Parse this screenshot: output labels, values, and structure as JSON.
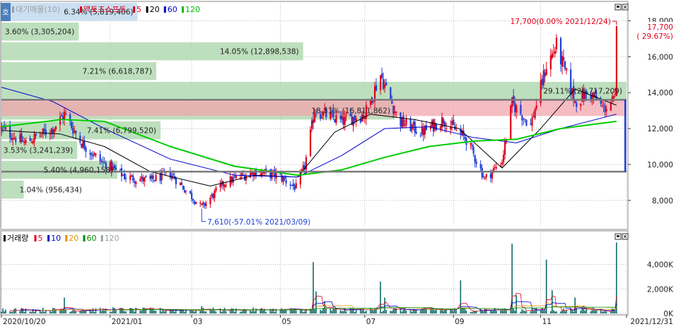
{
  "header": {
    "main_legend": [
      {
        "text": "대기매물(10)",
        "color": "#9aa0a6"
      },
      {
        "text": "액토즈소프트",
        "color": "#e0001a"
      },
      {
        "text": "5",
        "color": "#e0001a"
      },
      {
        "text": "20",
        "color": "#000000"
      },
      {
        "text": "60",
        "color": "#0000cc"
      },
      {
        "text": "120",
        "color": "#00bb00"
      }
    ],
    "volume_legend": [
      {
        "text": "거래량",
        "color": "#000000"
      },
      {
        "text": "5",
        "color": "#e0001a"
      },
      {
        "text": "10",
        "color": "#0000cc"
      },
      {
        "text": "20",
        "color": "#e09000"
      },
      {
        "text": "60",
        "color": "#008800"
      },
      {
        "text": "120",
        "color": "#9aa0a6"
      }
    ],
    "tab_label": "호"
  },
  "colors": {
    "up": "#e0001a",
    "down": "#1f3fd6",
    "ma5": "#e0001a",
    "ma20": "#000000",
    "ma60": "#0000cc",
    "ma120": "#00cc00",
    "supply_bar": "#b6dcb6",
    "supply_bar_top": "#c5dcee",
    "resistance_band": "#f2a6ad",
    "volume_bar": "#0f6b6b"
  },
  "chart_data": [
    {
      "type": "candlestick",
      "x_range": [
        "2020/10/20",
        "2021/12/31"
      ],
      "x_ticks": [
        {
          "date": "2020/10/20",
          "label": "2020/10/20"
        },
        {
          "date": "2021/01/04",
          "label": "2021/01"
        },
        {
          "date": "2021/03/02",
          "label": "03"
        },
        {
          "date": "2021/05/03",
          "label": "05"
        },
        {
          "date": "2021/07/01",
          "label": "07"
        },
        {
          "date": "2021/09/01",
          "label": "09"
        },
        {
          "date": "2021/11/01",
          "label": "11"
        },
        {
          "date": "2021/12/31",
          "label": "2021/12/31"
        }
      ],
      "ylim": [
        6500,
        19000
      ],
      "y_ticks": [
        8000,
        10000,
        12000,
        14000,
        16000,
        18000
      ],
      "y_tick_labels": [
        "8,000",
        "10,000",
        "12,000",
        "14,000",
        "16,000",
        "18,000"
      ],
      "grid": true,
      "last_price": {
        "value": 17700,
        "label_price": "17,700",
        "label_change": "( 29.67%)"
      },
      "supply_zones": [
        {
          "low": 18000,
          "high": 19000,
          "ratio": 0.0634,
          "label": "6.34% (5,819,406)"
        },
        {
          "low": 16900,
          "high": 17900,
          "ratio": 0.036,
          "label": "3.60% (3,305,204)"
        },
        {
          "low": 15800,
          "high": 16800,
          "ratio": 0.1405,
          "label": "14.05% (12,898,538)"
        },
        {
          "low": 14700,
          "high": 15700,
          "ratio": 0.0721,
          "label": "7.21% (6,618,787)"
        },
        {
          "low": 13600,
          "high": 14600,
          "ratio": 0.2911,
          "label": "29.11% (26,717,209)"
        },
        {
          "low": 12500,
          "high": 13500,
          "ratio": 0.1831,
          "label": "18.31% (16,811,862)"
        },
        {
          "low": 11400,
          "high": 12400,
          "ratio": 0.0741,
          "label": "7.41% (6,799,520)"
        },
        {
          "low": 10300,
          "high": 11300,
          "ratio": 0.0353,
          "label": "3.53% (3,241,239)"
        },
        {
          "low": 9200,
          "high": 10200,
          "ratio": 0.054,
          "label": "5.40% (4,960,158)"
        },
        {
          "low": 8100,
          "high": 9100,
          "ratio": 0.0104,
          "label": "1.04% (956,434)"
        }
      ],
      "resistance_band": {
        "low": 12700,
        "high": 13600
      },
      "horizontal_lines": [
        13600,
        9600
      ],
      "annotations": [
        {
          "text": "17,700(0.00% 2021/12/24)",
          "date": "2021/12/24",
          "value": 17700,
          "kind": "high"
        },
        {
          "text": "7,610(-57.01% 2021/03/09)",
          "date": "2021/03/09",
          "value": 7610,
          "kind": "low"
        }
      ],
      "price_path": [
        {
          "date": "2020/10/20",
          "value": 12000
        },
        {
          "date": "2020/11/05",
          "value": 11200
        },
        {
          "date": "2020/11/25",
          "value": 12000
        },
        {
          "date": "2020/12/03",
          "value": 12800
        },
        {
          "date": "2020/12/15",
          "value": 11200
        },
        {
          "date": "2020/12/28",
          "value": 10200
        },
        {
          "date": "2021/01/15",
          "value": 9300
        },
        {
          "date": "2021/02/01",
          "value": 9100
        },
        {
          "date": "2021/02/15",
          "value": 9500
        },
        {
          "date": "2021/03/09",
          "value": 7610
        },
        {
          "date": "2021/03/25",
          "value": 9000
        },
        {
          "date": "2021/04/15",
          "value": 9600
        },
        {
          "date": "2021/05/01",
          "value": 9400
        },
        {
          "date": "2021/05/14",
          "value": 8700
        },
        {
          "date": "2021/05/20",
          "value": 9900
        },
        {
          "date": "2021/05/27",
          "value": 13000
        },
        {
          "date": "2021/06/15",
          "value": 12400
        },
        {
          "date": "2021/07/01",
          "value": 12800
        },
        {
          "date": "2021/07/12",
          "value": 15000
        },
        {
          "date": "2021/07/25",
          "value": 12400
        },
        {
          "date": "2021/08/10",
          "value": 11800
        },
        {
          "date": "2021/08/25",
          "value": 12500
        },
        {
          "date": "2021/09/10",
          "value": 11400
        },
        {
          "date": "2021/09/23",
          "value": 9200
        },
        {
          "date": "2021/10/05",
          "value": 10200
        },
        {
          "date": "2021/10/12",
          "value": 13400
        },
        {
          "date": "2021/10/25",
          "value": 12200
        },
        {
          "date": "2021/11/05",
          "value": 15500
        },
        {
          "date": "2021/11/12",
          "value": 16600
        },
        {
          "date": "2021/11/25",
          "value": 13500
        },
        {
          "date": "2021/12/05",
          "value": 14000
        },
        {
          "date": "2021/12/15",
          "value": 13100
        },
        {
          "date": "2021/12/23",
          "value": 13600
        },
        {
          "date": "2021/12/24",
          "value": 17700
        }
      ],
      "moving_averages": {
        "ma20": [
          {
            "date": "2020/10/20",
            "value": 11900
          },
          {
            "date": "2020/11/30",
            "value": 11700
          },
          {
            "date": "2020/12/31",
            "value": 11000
          },
          {
            "date": "2021/02/01",
            "value": 9600
          },
          {
            "date": "2021/03/15",
            "value": 8800
          },
          {
            "date": "2021/04/15",
            "value": 9400
          },
          {
            "date": "2021/05/15",
            "value": 9300
          },
          {
            "date": "2021/06/10",
            "value": 11800
          },
          {
            "date": "2021/07/05",
            "value": 12800
          },
          {
            "date": "2021/08/05",
            "value": 12500
          },
          {
            "date": "2021/09/05",
            "value": 12000
          },
          {
            "date": "2021/10/05",
            "value": 9800
          },
          {
            "date": "2021/11/01",
            "value": 12000
          },
          {
            "date": "2021/11/25",
            "value": 14200
          },
          {
            "date": "2021/12/24",
            "value": 13300
          }
        ],
        "ma60": [
          {
            "date": "2020/10/20",
            "value": 14300
          },
          {
            "date": "2020/11/25",
            "value": 13500
          },
          {
            "date": "2020/12/31",
            "value": 12000
          },
          {
            "date": "2021/02/15",
            "value": 10300
          },
          {
            "date": "2021/04/01",
            "value": 9400
          },
          {
            "date": "2021/05/15",
            "value": 9300
          },
          {
            "date": "2021/06/15",
            "value": 10500
          },
          {
            "date": "2021/07/15",
            "value": 12000
          },
          {
            "date": "2021/08/15",
            "value": 12100
          },
          {
            "date": "2021/09/15",
            "value": 11500
          },
          {
            "date": "2021/10/15",
            "value": 11200
          },
          {
            "date": "2021/11/15",
            "value": 12000
          },
          {
            "date": "2021/12/24",
            "value": 12800
          }
        ],
        "ma120": [
          {
            "date": "2020/10/20",
            "value": 12100
          },
          {
            "date": "2020/12/01",
            "value": 12500
          },
          {
            "date": "2020/12/31",
            "value": 12400
          },
          {
            "date": "2021/02/15",
            "value": 11000
          },
          {
            "date": "2021/04/01",
            "value": 9900
          },
          {
            "date": "2021/05/15",
            "value": 9400
          },
          {
            "date": "2021/06/15",
            "value": 9700
          },
          {
            "date": "2021/07/15",
            "value": 10400
          },
          {
            "date": "2021/08/15",
            "value": 11000
          },
          {
            "date": "2021/09/15",
            "value": 11300
          },
          {
            "date": "2021/10/15",
            "value": 11400
          },
          {
            "date": "2021/11/15",
            "value": 12000
          },
          {
            "date": "2021/12/24",
            "value": 12400
          }
        ]
      }
    },
    {
      "type": "bar",
      "title": "거래량",
      "ylim": [
        0,
        6000000
      ],
      "y_ticks": [
        0,
        2000000,
        4000000
      ],
      "y_tick_labels": [
        "0K",
        "2,000K",
        "4,000K"
      ],
      "baseline": 300000,
      "spikes": [
        {
          "date": "2020/12/03",
          "value": 1300000
        },
        {
          "date": "2021/01/06",
          "value": 500000
        },
        {
          "date": "2021/03/09",
          "value": 600000
        },
        {
          "date": "2021/05/26",
          "value": 4200000
        },
        {
          "date": "2021/05/28",
          "value": 1800000
        },
        {
          "date": "2021/06/03",
          "value": 1000000
        },
        {
          "date": "2021/07/12",
          "value": 2600000
        },
        {
          "date": "2021/07/15",
          "value": 1300000
        },
        {
          "date": "2021/09/06",
          "value": 2700000
        },
        {
          "date": "2021/10/12",
          "value": 5700000
        },
        {
          "date": "2021/10/15",
          "value": 1500000
        },
        {
          "date": "2021/11/05",
          "value": 4400000
        },
        {
          "date": "2021/11/09",
          "value": 1900000
        },
        {
          "date": "2021/11/25",
          "value": 1300000
        },
        {
          "date": "2021/12/24",
          "value": 5800000
        }
      ]
    }
  ]
}
